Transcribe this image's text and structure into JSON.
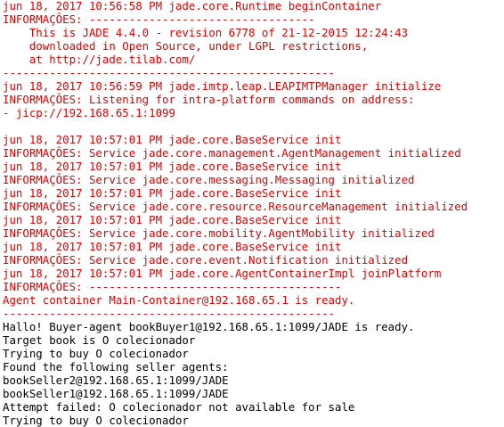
{
  "colors": {
    "background": "#ffffff",
    "stderr": "#e00000",
    "stdout": "#000000"
  },
  "console": {
    "lines": [
      {
        "text": "jun 18, 2017 10:56:58 PM jade.core.Runtime beginContainer",
        "stream": "err"
      },
      {
        "text": "INFORMAÇÕES: ----------------------------------",
        "stream": "err"
      },
      {
        "text": "    This is JADE 4.4.0 - revision 6778 of 21-12-2015 12:24:43",
        "stream": "err"
      },
      {
        "text": "    downloaded in Open Source, under LGPL restrictions,",
        "stream": "err"
      },
      {
        "text": "    at http://jade.tilab.com/",
        "stream": "err"
      },
      {
        "text": "--------------------------------------------------",
        "stream": "err"
      },
      {
        "text": "jun 18, 2017 10:56:59 PM jade.imtp.leap.LEAPIMTPManager initialize",
        "stream": "err"
      },
      {
        "text": "INFORMAÇÕES: Listening for intra-platform commands on address:",
        "stream": "err"
      },
      {
        "text": "- jicp://192.168.65.1:1099",
        "stream": "err"
      },
      {
        "text": "",
        "stream": "err"
      },
      {
        "text": "jun 18, 2017 10:57:01 PM jade.core.BaseService init",
        "stream": "err"
      },
      {
        "text": "INFORMAÇÕES: Service jade.core.management.AgentManagement initialized",
        "stream": "err"
      },
      {
        "text": "jun 18, 2017 10:57:01 PM jade.core.BaseService init",
        "stream": "err"
      },
      {
        "text": "INFORMAÇÕES: Service jade.core.messaging.Messaging initialized",
        "stream": "err"
      },
      {
        "text": "jun 18, 2017 10:57:01 PM jade.core.BaseService init",
        "stream": "err"
      },
      {
        "text": "INFORMAÇÕES: Service jade.core.resource.ResourceManagement initialized",
        "stream": "err"
      },
      {
        "text": "jun 18, 2017 10:57:01 PM jade.core.BaseService init",
        "stream": "err"
      },
      {
        "text": "INFORMAÇÕES: Service jade.core.mobility.AgentMobility initialized",
        "stream": "err"
      },
      {
        "text": "jun 18, 2017 10:57:01 PM jade.core.BaseService init",
        "stream": "err"
      },
      {
        "text": "INFORMAÇÕES: Service jade.core.event.Notification initialized",
        "stream": "err"
      },
      {
        "text": "jun 18, 2017 10:57:01 PM jade.core.AgentContainerImpl joinPlatform",
        "stream": "err"
      },
      {
        "text": "INFORMAÇÕES: --------------------------------------",
        "stream": "err"
      },
      {
        "text": "Agent container Main-Container@192.168.65.1 is ready.",
        "stream": "err"
      },
      {
        "text": "--------------------------------------------------",
        "stream": "err"
      },
      {
        "text": "Hallo! Buyer-agent bookBuyer1@192.168.65.1:1099/JADE is ready.",
        "stream": "out"
      },
      {
        "text": "Target book is O colecionador",
        "stream": "out"
      },
      {
        "text": "Trying to buy O colecionador",
        "stream": "out"
      },
      {
        "text": "Found the following seller agents:",
        "stream": "out"
      },
      {
        "text": "bookSeller2@192.168.65.1:1099/JADE",
        "stream": "out"
      },
      {
        "text": "bookSeller1@192.168.65.1:1099/JADE",
        "stream": "out"
      },
      {
        "text": "Attempt failed: O colecionador not available for sale",
        "stream": "out"
      },
      {
        "text": "Trying to buy O colecionador",
        "stream": "out"
      }
    ]
  }
}
